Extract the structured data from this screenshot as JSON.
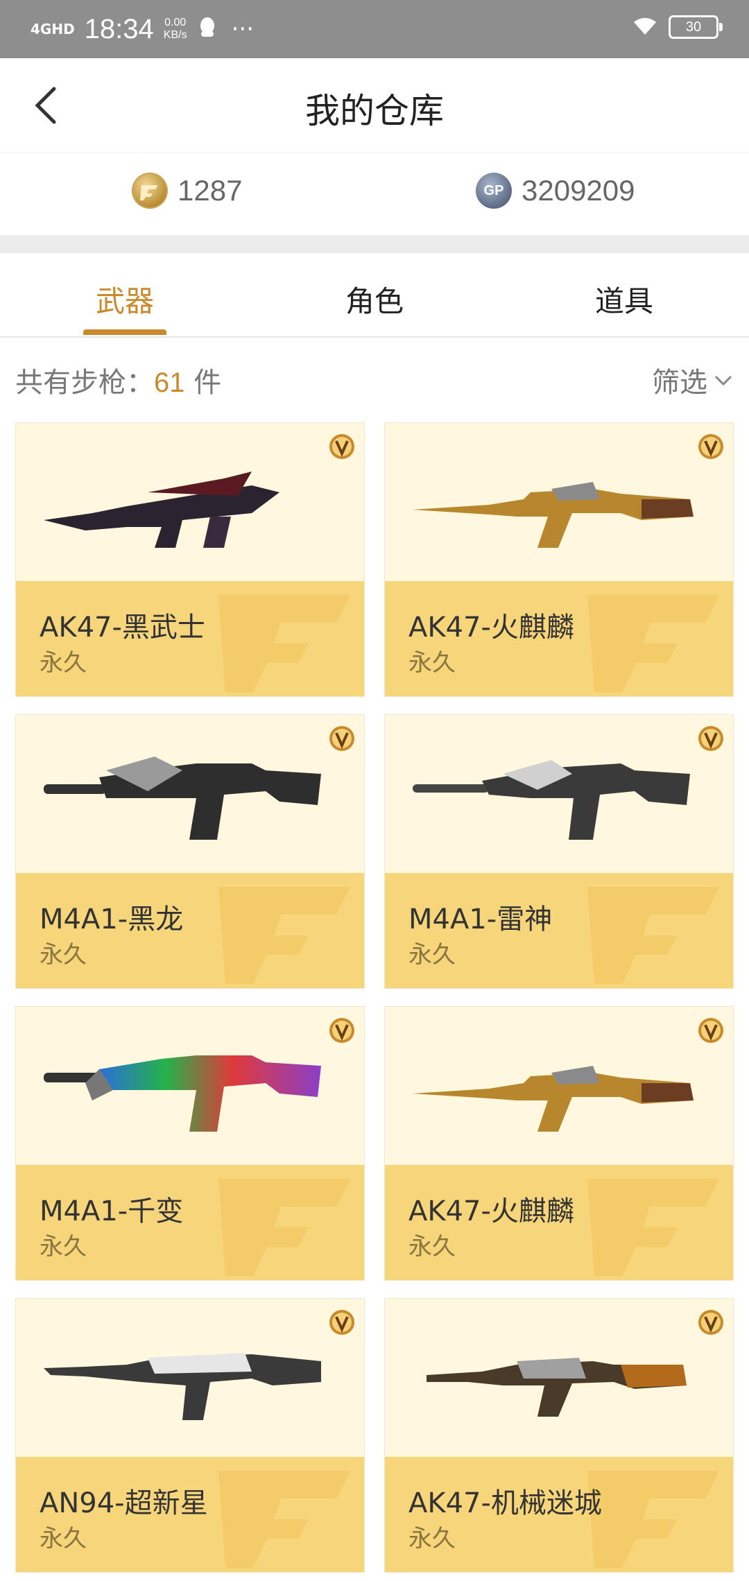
{
  "status_bar": {
    "network": "4GHD",
    "time": "18:34",
    "speed_value": "0.00",
    "speed_unit": "KB/s",
    "battery": "30"
  },
  "header": {
    "title": "我的仓库"
  },
  "currency": {
    "cf_points": "1287",
    "gp_label": "GP",
    "gp_points": "3209209"
  },
  "tabs": [
    {
      "label": "武器",
      "active": true
    },
    {
      "label": "角色",
      "active": false
    },
    {
      "label": "道具",
      "active": false
    }
  ],
  "summary": {
    "prefix": "共有步枪：",
    "count": "61",
    "suffix": " 件",
    "filter_label": "筛选"
  },
  "items": [
    {
      "name": "AK47-黑武士",
      "duration": "永久",
      "gun_icon": "rifle-ak47-black"
    },
    {
      "name": "AK47-火麒麟",
      "duration": "永久",
      "gun_icon": "rifle-ak47-gold"
    },
    {
      "name": "M4A1-黑龙",
      "duration": "永久",
      "gun_icon": "rifle-m4a1-dragon"
    },
    {
      "name": "M4A1-雷神",
      "duration": "永久",
      "gun_icon": "rifle-m4a1-silver"
    },
    {
      "name": "M4A1-千变",
      "duration": "永久",
      "gun_icon": "rifle-m4a1-rainbow"
    },
    {
      "name": "AK47-火麒麟",
      "duration": "永久",
      "gun_icon": "rifle-ak47-gold"
    },
    {
      "name": "AN94-超新星",
      "duration": "永久",
      "gun_icon": "rifle-an94-white"
    },
    {
      "name": "AK47-机械迷城",
      "duration": "永久",
      "gun_icon": "rifle-ak47-mech"
    }
  ],
  "colors": {
    "accent": "#c98a2b",
    "card_top": "#fff8de",
    "card_bottom": "#f7d57a"
  }
}
